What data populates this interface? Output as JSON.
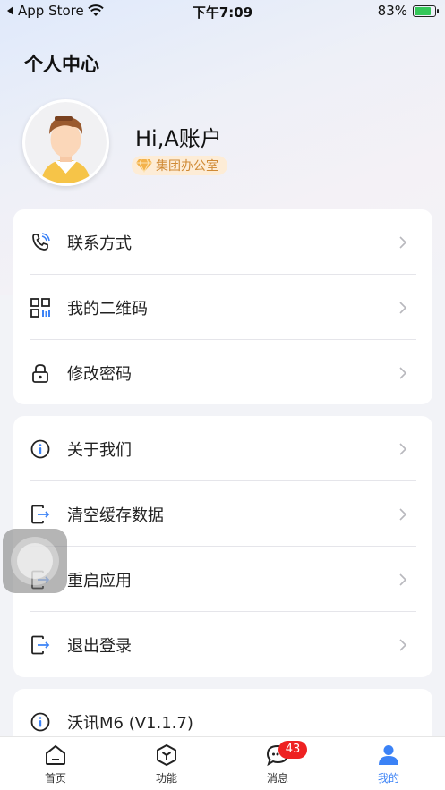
{
  "status_bar": {
    "back_app": "App Store",
    "time": "下午7:09",
    "battery": "83%",
    "battery_level": 0.83
  },
  "header": {
    "title": "个人中心",
    "greeting": "Hi,A账户",
    "badge": "集团办公室"
  },
  "group1": {
    "items": [
      {
        "label": "联系方式",
        "icon": "phone-icon"
      },
      {
        "label": "我的二维码",
        "icon": "qrcode-icon"
      },
      {
        "label": "修改密码",
        "icon": "lock-icon"
      }
    ]
  },
  "group2": {
    "items": [
      {
        "label": "关于我们",
        "icon": "info-icon"
      },
      {
        "label": "清空缓存数据",
        "icon": "exit-icon"
      },
      {
        "label": "重启应用",
        "icon": "exit-icon"
      },
      {
        "label": "退出登录",
        "icon": "exit-icon"
      }
    ]
  },
  "group3": {
    "items": [
      {
        "label": "沃讯M6 (V1.1.7)",
        "icon": "info-icon"
      }
    ]
  },
  "tabbar": {
    "tabs": [
      {
        "label": "首页",
        "icon": "home-icon"
      },
      {
        "label": "功能",
        "icon": "cube-icon"
      },
      {
        "label": "消息",
        "icon": "chat-icon",
        "badge": "43"
      },
      {
        "label": "我的",
        "icon": "user-icon",
        "active": true
      }
    ]
  },
  "colors": {
    "accent": "#3b82f6",
    "badge_bg": "#fdecd6",
    "badge_text": "#d08a35",
    "notification": "#ee2222"
  }
}
